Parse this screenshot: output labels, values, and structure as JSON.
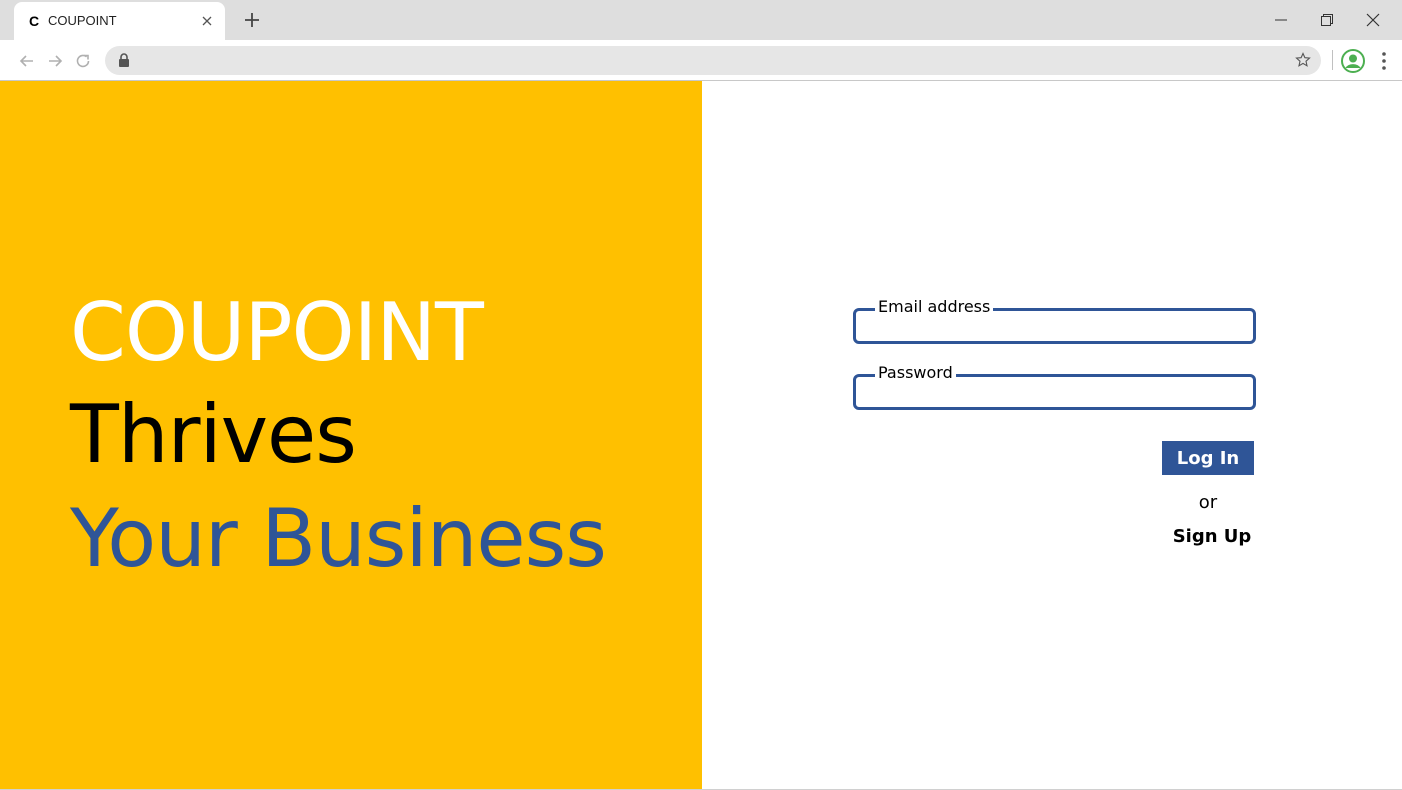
{
  "browser": {
    "tab_title": "COUPOINT",
    "favicon_letter": "C",
    "address": ""
  },
  "hero": {
    "line1": "COUPOINT",
    "line2": "Thrives",
    "line3": "Your Business",
    "colors": {
      "background": "#ffc000",
      "line1": "#ffffff",
      "line2": "#000000",
      "line3": "#2f5597"
    }
  },
  "login": {
    "email_label": "Email address",
    "email_value": "",
    "password_label": "Password",
    "password_value": "",
    "login_button": "Log In",
    "or_text": "or",
    "signup_link": "Sign Up",
    "accent_color": "#2f5597"
  }
}
